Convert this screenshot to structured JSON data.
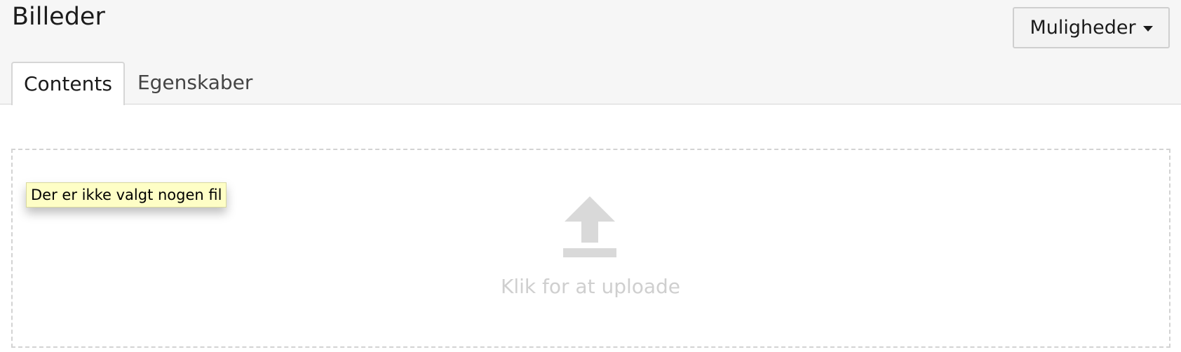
{
  "header": {
    "title": "Billeder",
    "options_label": "Muligheder"
  },
  "tabs": [
    {
      "label": "Contents",
      "active": true
    },
    {
      "label": "Egenskaber",
      "active": false
    }
  ],
  "dropzone": {
    "label": "Klik for at uploade",
    "icon": "upload-icon",
    "tooltip": "Der er ikke valgt nogen fil"
  },
  "colors": {
    "header_bg": "#f6f6f6",
    "upload_icon": "#d9d9d9",
    "upload_text": "#cfcfcf",
    "tooltip_bg": "#fefec6"
  }
}
